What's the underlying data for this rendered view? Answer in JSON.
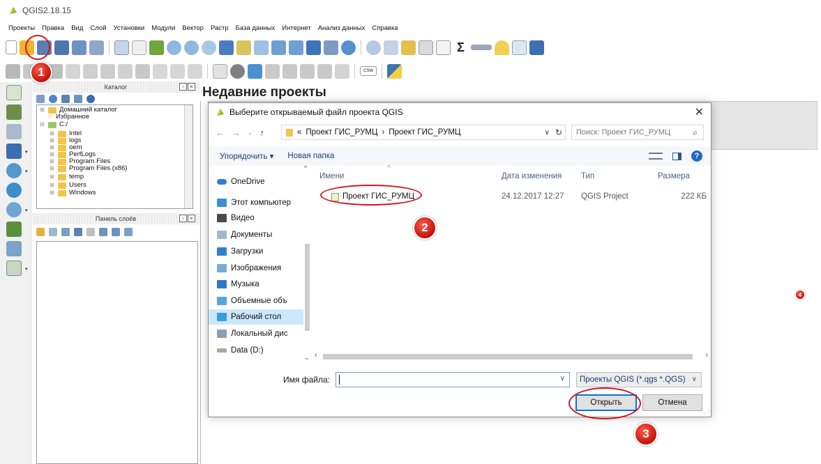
{
  "window": {
    "title": "QGIS2.18.15"
  },
  "menu": [
    "Проекты",
    "Правка",
    "Вид",
    "Слой",
    "Установки",
    "Модули",
    "Вектор",
    "Растр",
    "База данных",
    "Интернет",
    "Анализ данных",
    "Справка"
  ],
  "catalog": {
    "header": "Каталог",
    "items": [
      {
        "label": "Домашний каталог",
        "type": "folder"
      },
      {
        "label": "Избранное",
        "type": "star"
      },
      {
        "label": "C:/",
        "type": "drive"
      },
      {
        "label": "Intel",
        "type": "folder"
      },
      {
        "label": "logs",
        "type": "folder"
      },
      {
        "label": "oem",
        "type": "folder"
      },
      {
        "label": "PerfLogs",
        "type": "folder"
      },
      {
        "label": "Program Files",
        "type": "folder"
      },
      {
        "label": "Program Files (x86)",
        "type": "folder"
      },
      {
        "label": "temp",
        "type": "folder"
      },
      {
        "label": "Users",
        "type": "folder"
      },
      {
        "label": "Windows",
        "type": "folder"
      }
    ]
  },
  "layers_panel": {
    "header": "Панель слоёв"
  },
  "recent": {
    "title": "Недавние проекты"
  },
  "dialog": {
    "title": "Выберите открываемый файл проекта QGIS",
    "address": [
      "«",
      "Проект ГИС_РУМЦ",
      "›",
      "Проект ГИС_РУМЦ"
    ],
    "search_placeholder": "Поиск: Проект ГИС_РУМЦ",
    "organize": "Упорядочить ▾",
    "new_folder": "Новая папка",
    "nav": [
      {
        "label": "OneDrive",
        "icon": "onedrive-icon"
      },
      {
        "label": "Этот компьютер",
        "icon": "computer-icon"
      },
      {
        "label": "Видео",
        "icon": "video-folder-icon"
      },
      {
        "label": "Документы",
        "icon": "documents-folder-icon"
      },
      {
        "label": "Загрузки",
        "icon": "downloads-folder-icon"
      },
      {
        "label": "Изображения",
        "icon": "pictures-folder-icon"
      },
      {
        "label": "Музыка",
        "icon": "music-folder-icon"
      },
      {
        "label": "Объемные объ",
        "icon": "3d-objects-folder-icon"
      },
      {
        "label": "Рабочий стол",
        "icon": "desktop-folder-icon"
      },
      {
        "label": "Локальный дис",
        "icon": "local-disk-icon"
      },
      {
        "label": "Data (D:)",
        "icon": "drive-icon"
      }
    ],
    "columns": {
      "name": "Имени",
      "date": "Дата изменения",
      "type": "Тип",
      "size": "Размера"
    },
    "files": [
      {
        "name": "Проект ГИС_РУМЦ",
        "date": "24.12.2017 12:27",
        "type": "QGIS Project",
        "size": "222 КБ"
      }
    ],
    "filename_label": "Имя файла:",
    "filename_value": "",
    "filter": "Проекты QGIS (*.qgs *.QGS)",
    "open": "Открыть",
    "cancel": "Отмена"
  },
  "annotations": [
    "1",
    "2",
    "3",
    "4"
  ],
  "colors": {
    "annotation": "#d3141c",
    "accent": "#0078d7",
    "selection": "#cce8ff"
  }
}
